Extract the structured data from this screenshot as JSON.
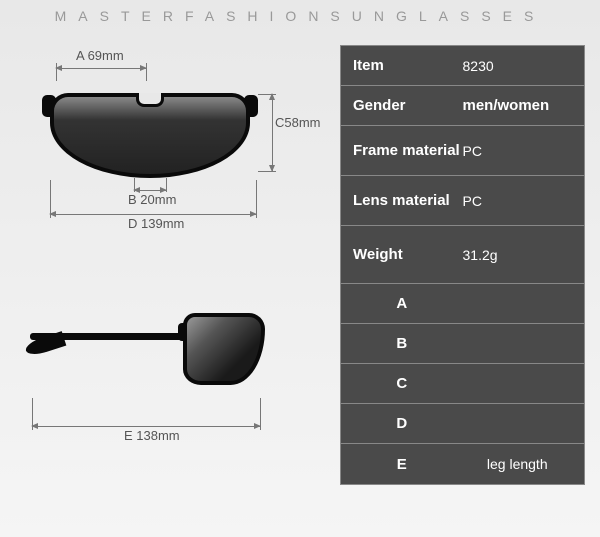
{
  "header": "MASTERFASHIONSUNGLASSES",
  "dimensions": {
    "a": "A 69mm",
    "b": "B 20mm",
    "c": "C58mm",
    "d": "D 139mm",
    "e": "E 138mm"
  },
  "specs": {
    "item_label": "Item",
    "item_value": "8230",
    "gender_label": "Gender",
    "gender_value": "men/women",
    "frame_label": "Frame material",
    "frame_value": "PC",
    "lens_label": "Lens material",
    "lens_value": "PC",
    "weight_label": "Weight",
    "weight_value": "31.2g",
    "a_label": "A",
    "a_value": "",
    "b_label": "B",
    "b_value": "",
    "c_label": "C",
    "c_value": "",
    "d_label": "D",
    "d_value": "",
    "e_label": "E",
    "e_value": "leg length"
  }
}
